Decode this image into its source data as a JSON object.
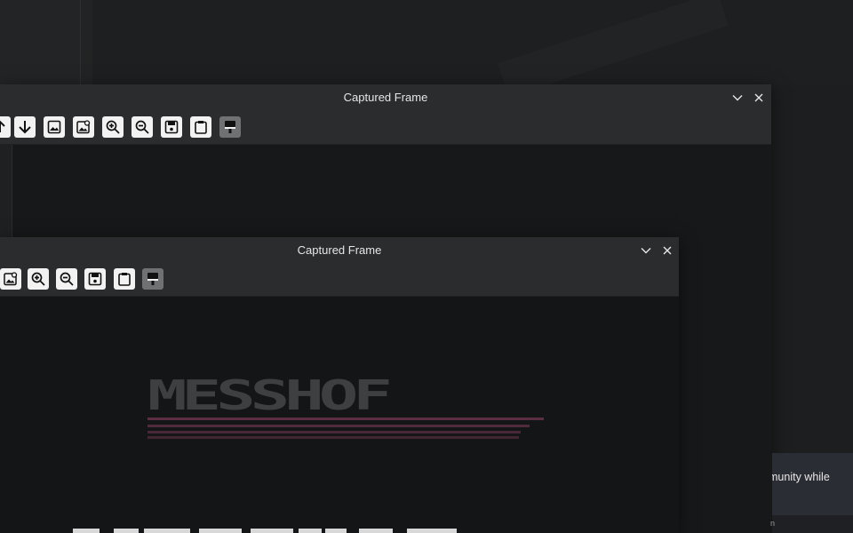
{
  "window_back": {
    "title": "Captured Frame",
    "toolbar": [
      {
        "icon": "arrow-up-partial-icon",
        "name": "tool-partial"
      },
      {
        "icon": "arrow-down-icon",
        "name": "tool-move-down"
      },
      {
        "icon": "image-icon",
        "name": "tool-image"
      },
      {
        "icon": "image-search-icon",
        "name": "tool-image-search"
      },
      {
        "icon": "zoom-in-icon",
        "name": "tool-zoom-in"
      },
      {
        "icon": "zoom-out-icon",
        "name": "tool-zoom-out"
      },
      {
        "icon": "save-icon",
        "name": "tool-save"
      },
      {
        "icon": "clipboard-icon",
        "name": "tool-clipboard"
      },
      {
        "icon": "paint-brush-icon",
        "name": "tool-paint",
        "disabled": true
      }
    ]
  },
  "window_front": {
    "title": "Captured Frame",
    "toolbar": [
      {
        "icon": "image-search-icon",
        "name": "tool-image-search"
      },
      {
        "icon": "zoom-in-icon",
        "name": "tool-zoom-in"
      },
      {
        "icon": "zoom-out-icon",
        "name": "tool-zoom-out"
      },
      {
        "icon": "save-icon",
        "name": "tool-save"
      },
      {
        "icon": "clipboard-icon",
        "name": "tool-clipboard"
      },
      {
        "icon": "paint-brush-icon",
        "name": "tool-paint",
        "disabled": true
      }
    ],
    "captured_logo_text": "MESSHOF"
  },
  "notification": {
    "text": "munity while",
    "subtext": "n"
  },
  "colors": {
    "titlebar": "#2a2c2e",
    "logo_stripe": "#5a2f44",
    "notification_bg": "#2b2d34"
  }
}
